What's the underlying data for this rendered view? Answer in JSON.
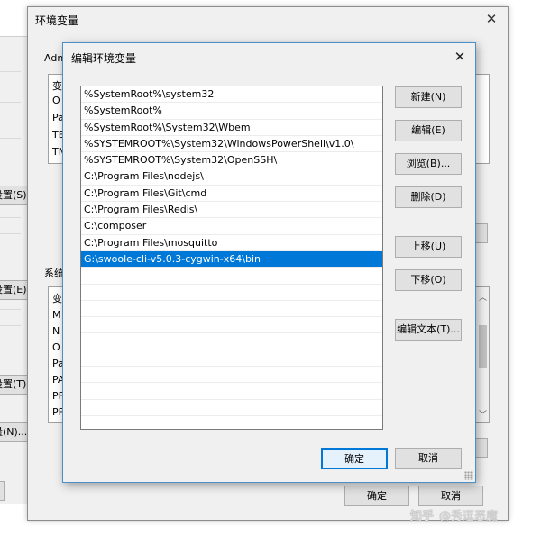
{
  "system_props": {
    "btn_s": "设置(S)...",
    "btn_e": "设置(E)...",
    "btn_t": "设置(T)...",
    "btn_n": "量(N)..."
  },
  "env_window": {
    "title": "环境变量",
    "user_group": "Adm",
    "user_list_header": "变",
    "user_rows": [
      "O",
      "Pa",
      "TE",
      "TM"
    ],
    "system_group": "系统",
    "system_list_header": "变",
    "system_rows": [
      "M",
      "N",
      "O",
      "Pa",
      "PA",
      "PF",
      "PF"
    ],
    "ok": "确定",
    "cancel": "取消"
  },
  "dialog": {
    "title": "编辑环境变量",
    "paths": [
      "%SystemRoot%\\system32",
      "%SystemRoot%",
      "%SystemRoot%\\System32\\Wbem",
      "%SYSTEMROOT%\\System32\\WindowsPowerShell\\v1.0\\",
      "%SYSTEMROOT%\\System32\\OpenSSH\\",
      "C:\\Program Files\\nodejs\\",
      "C:\\Program Files\\Git\\cmd",
      "C:\\Program Files\\Redis\\",
      "C:\\composer",
      "C:\\Program Files\\mosquitto",
      "G:\\swoole-cli-v5.0.3-cygwin-x64\\bin",
      "",
      "",
      "",
      "",
      "",
      "",
      "",
      "",
      ""
    ],
    "selected_index": 10,
    "buttons": {
      "new": "新建(N)",
      "edit": "编辑(E)",
      "browse": "浏览(B)...",
      "delete": "删除(D)",
      "move_up": "上移(U)",
      "move_down": "下移(O)",
      "edit_text": "编辑文本(T)...",
      "ok": "确定",
      "cancel": "取消"
    }
  },
  "watermark": {
    "brand": "知乎",
    "author": "@秀逗恶魔"
  }
}
